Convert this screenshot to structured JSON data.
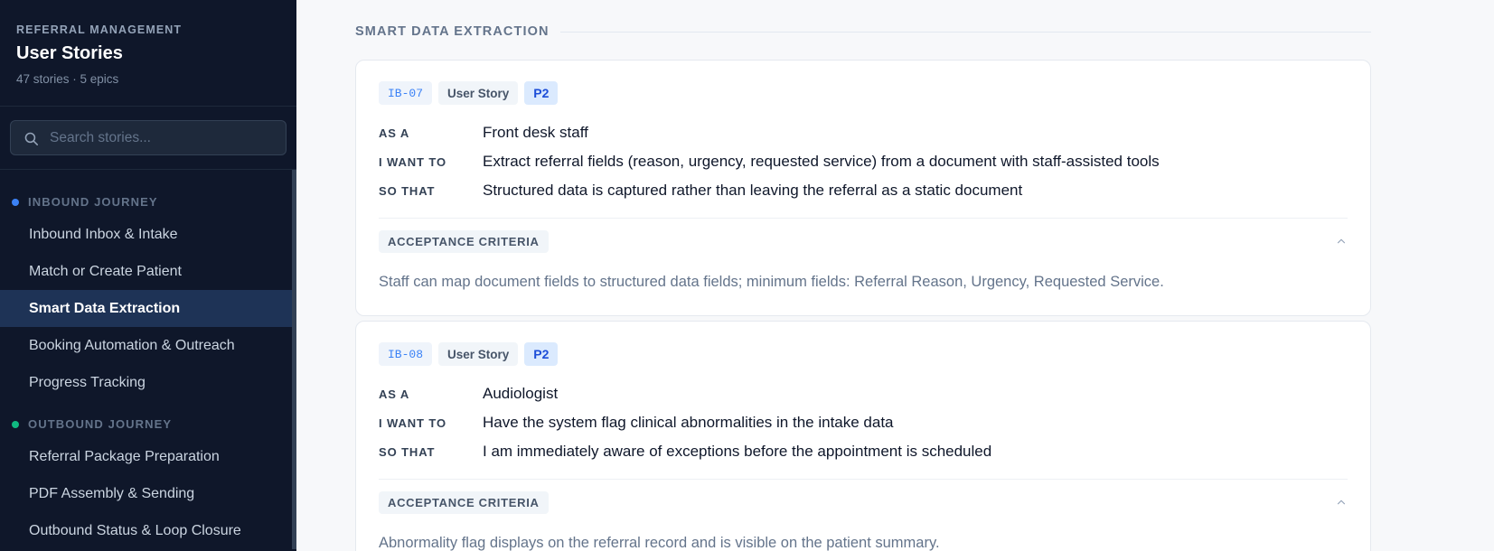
{
  "sidebar": {
    "eyebrow": "REFERRAL MANAGEMENT",
    "title": "User Stories",
    "subtitle": "47 stories · 5 epics",
    "search_placeholder": "Search stories...",
    "epics": [
      {
        "name": "INBOUND JOURNEY",
        "color": "#3b82f6",
        "items": [
          {
            "label": "Inbound Inbox & Intake",
            "active": false
          },
          {
            "label": "Match or Create Patient",
            "active": false
          },
          {
            "label": "Smart Data Extraction",
            "active": true
          },
          {
            "label": "Booking Automation & Outreach",
            "active": false
          },
          {
            "label": "Progress Tracking",
            "active": false
          }
        ]
      },
      {
        "name": "OUTBOUND JOURNEY",
        "color": "#10b981",
        "items": [
          {
            "label": "Referral Package Preparation",
            "active": false
          },
          {
            "label": "PDF Assembly & Sending",
            "active": false
          },
          {
            "label": "Outbound Status & Loop Closure",
            "active": false
          }
        ]
      }
    ]
  },
  "main": {
    "section_title": "SMART DATA EXTRACTION",
    "stories": [
      {
        "id": "IB-07",
        "type": "User Story",
        "priority": "P2",
        "as_a_label": "AS A",
        "as_a": "Front desk staff",
        "i_want_label": "I WANT TO",
        "i_want": "Extract referral fields (reason, urgency, requested service) from a document with staff-assisted tools",
        "so_that_label": "SO THAT",
        "so_that": "Structured data is captured rather than leaving the referral as a static document",
        "ac_label": "ACCEPTANCE CRITERIA",
        "ac_text": "Staff can map document fields to structured data fields; minimum fields: Referral Reason, Urgency, Requested Service."
      },
      {
        "id": "IB-08",
        "type": "User Story",
        "priority": "P2",
        "as_a_label": "AS A",
        "as_a": "Audiologist",
        "i_want_label": "I WANT TO",
        "i_want": "Have the system flag clinical abnormalities in the intake data",
        "so_that_label": "SO THAT",
        "so_that": "I am immediately aware of exceptions before the appointment is scheduled",
        "ac_label": "ACCEPTANCE CRITERIA",
        "ac_text": "Abnormality flag displays on the referral record and is visible on the patient summary."
      }
    ]
  }
}
